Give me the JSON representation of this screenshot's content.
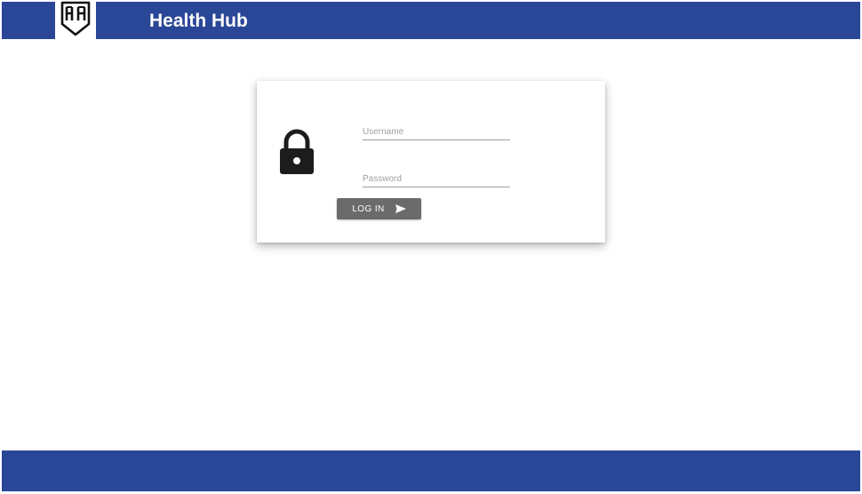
{
  "header": {
    "title": "Health Hub",
    "logo_icon": "shield-hh-logo-icon",
    "background_color": "#2a4797"
  },
  "login": {
    "lock_icon": "lock-icon",
    "username_placeholder": "Username",
    "password_placeholder": "Password",
    "submit_label": "LOG IN",
    "submit_icon": "send-icon",
    "button_color": "#6b6b6b"
  },
  "footer": {
    "background_color": "#2a4797"
  }
}
